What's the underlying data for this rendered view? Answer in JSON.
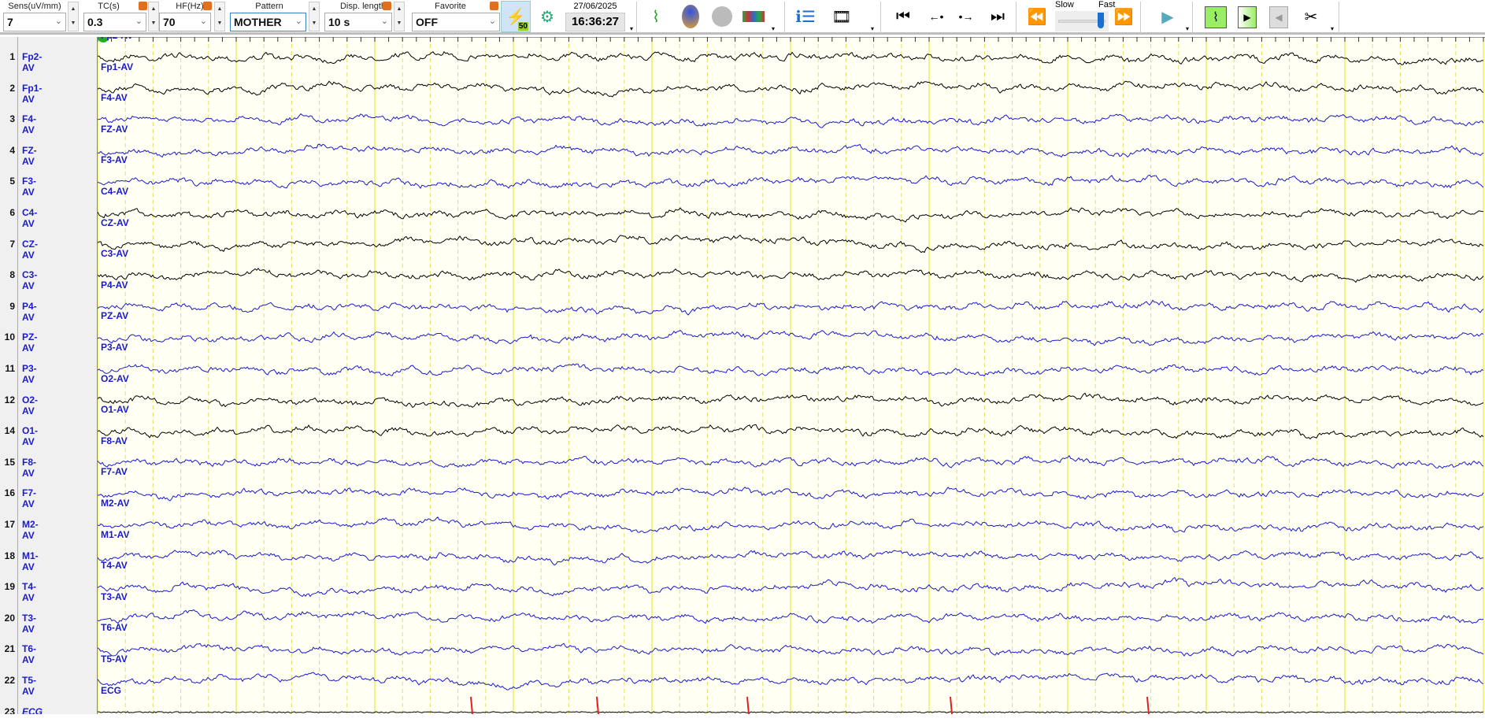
{
  "toolbar": {
    "sens": {
      "label": "Sens(uV/mm)",
      "value": "7"
    },
    "tc": {
      "label": "TC(s)",
      "value": "0.3"
    },
    "hf": {
      "label": "HF(Hz)",
      "value": "70"
    },
    "pattern": {
      "label": "Pattern",
      "value": "MOTHER"
    },
    "disp_length": {
      "label": "Disp. length",
      "value": "10 s"
    },
    "favorite": {
      "label": "Favorite",
      "value": "OFF"
    },
    "notch_badge": "50",
    "date": "27/06/2025",
    "time": "16:36:27",
    "speed": {
      "slow": "Slow",
      "fast": "Fast",
      "value": 0.9
    }
  },
  "channels": [
    {
      "num": "1",
      "name": "Fp2-AV",
      "color": "#000000"
    },
    {
      "num": "2",
      "name": "Fp1-AV",
      "color": "#000000"
    },
    {
      "num": "3",
      "name": "F4-AV",
      "color": "#1a1acc"
    },
    {
      "num": "4",
      "name": "FZ-AV",
      "color": "#1a1acc"
    },
    {
      "num": "5",
      "name": "F3-AV",
      "color": "#1a1acc"
    },
    {
      "num": "6",
      "name": "C4-AV",
      "color": "#000000"
    },
    {
      "num": "7",
      "name": "CZ-AV",
      "color": "#000000"
    },
    {
      "num": "8",
      "name": "C3-AV",
      "color": "#000000"
    },
    {
      "num": "9",
      "name": "P4-AV",
      "color": "#1a1acc"
    },
    {
      "num": "10",
      "name": "PZ-AV",
      "color": "#1a1acc"
    },
    {
      "num": "11",
      "name": "P3-AV",
      "color": "#1a1acc"
    },
    {
      "num": "12",
      "name": "O2-AV",
      "color": "#000000"
    },
    {
      "num": "14",
      "name": "O1-AV",
      "color": "#000000"
    },
    {
      "num": "15",
      "name": "F8-AV",
      "color": "#1a1acc"
    },
    {
      "num": "16",
      "name": "F7-AV",
      "color": "#1a1acc"
    },
    {
      "num": "17",
      "name": "M2-AV",
      "color": "#1a1acc"
    },
    {
      "num": "18",
      "name": "M1-AV",
      "color": "#1a1acc"
    },
    {
      "num": "19",
      "name": "T4-AV",
      "color": "#1a1acc"
    },
    {
      "num": "20",
      "name": "T3-AV",
      "color": "#1a1acc"
    },
    {
      "num": "21",
      "name": "T6-AV",
      "color": "#1a1acc"
    },
    {
      "num": "22",
      "name": "T5-AV",
      "color": "#1a1acc"
    },
    {
      "num": "23",
      "name": "ECG",
      "color": "#000000"
    }
  ],
  "colors": {
    "grid_major": "#f0e640",
    "grid_minor": "#e8e060",
    "ecg_marker": "#e02020",
    "background": "#fffff4"
  }
}
